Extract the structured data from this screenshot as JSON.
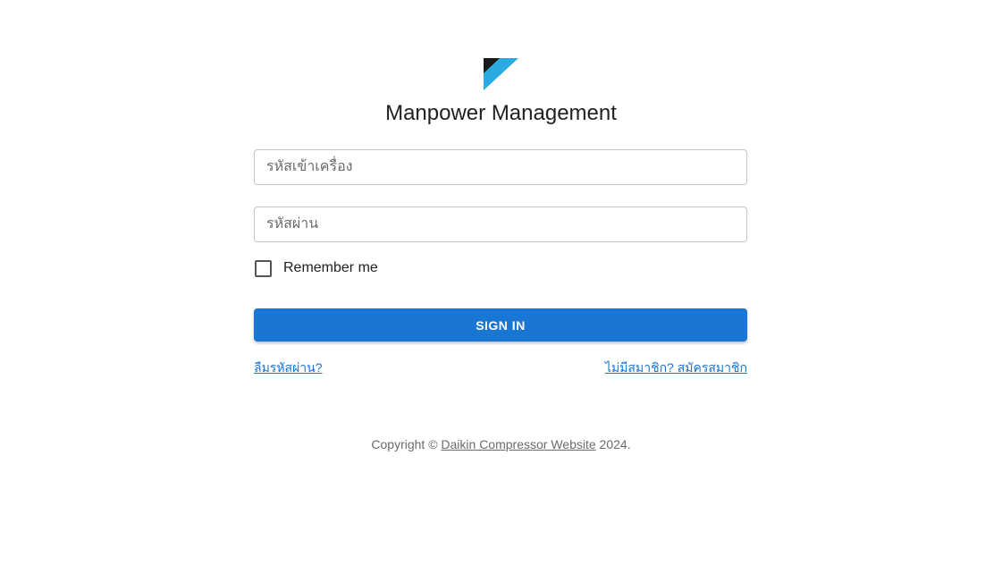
{
  "app": {
    "title": "Manpower Management",
    "logo_icon": "daikin-logo-icon",
    "brand_colors": {
      "logo_dark": "#1a1a1a",
      "logo_blue": "#29abe2",
      "accent": "#1976d2"
    }
  },
  "form": {
    "username_placeholder": "รหัสเข้าเครื่อง",
    "username_value": "",
    "password_placeholder": "รหัสผ่าน",
    "password_value": "",
    "remember_label": "Remember me",
    "remember_checked": false,
    "signin_label": "SIGN IN"
  },
  "links": {
    "forgot_password": "ลืมรหัสผ่าน?",
    "signup": "ไม่มีสมาชิก? สมัครสมาชิก"
  },
  "footer": {
    "prefix": "Copyright © ",
    "link_text": "Daikin Compressor Website",
    "suffix": " 2024."
  }
}
